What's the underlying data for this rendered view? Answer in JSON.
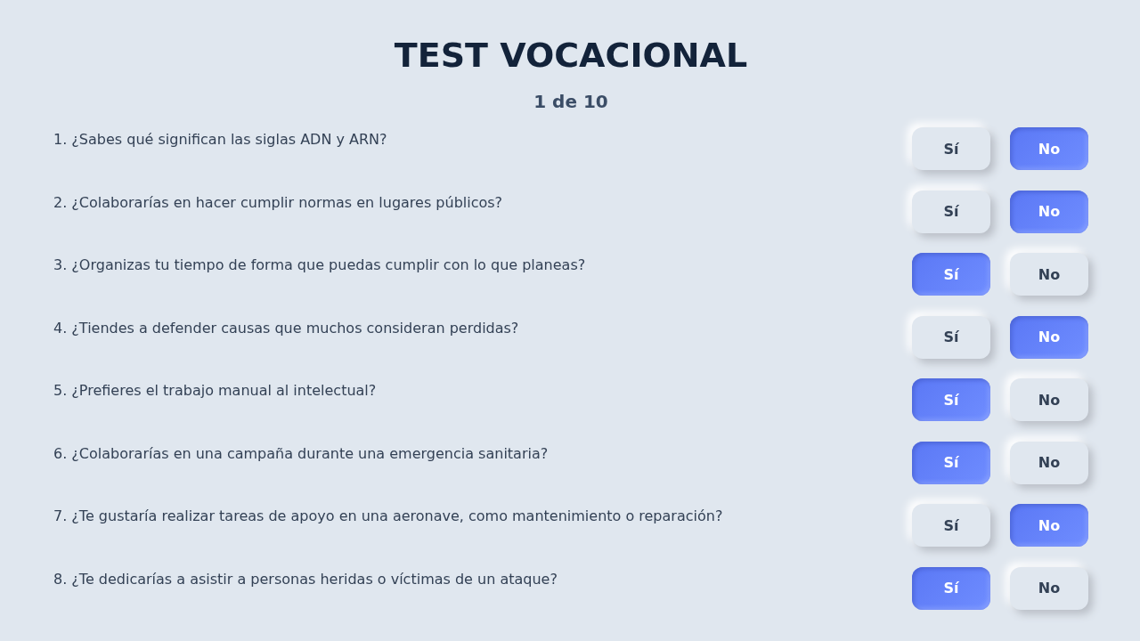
{
  "title": "TEST VOCACIONAL",
  "progress": "1 de 10",
  "questions": [
    {
      "text": "1. ¿Sabes qué significan las siglas ADN y ARN?",
      "options": [
        {
          "label": "Sí",
          "selected": false
        },
        {
          "label": "No",
          "selected": true
        }
      ]
    },
    {
      "text": "2. ¿Colaborarías en hacer cumplir normas en lugares públicos?",
      "options": [
        {
          "label": "Sí",
          "selected": false
        },
        {
          "label": "No",
          "selected": true
        }
      ]
    },
    {
      "text": "3. ¿Organizas tu tiempo de forma que puedas cumplir con lo que planeas?",
      "options": [
        {
          "label": "Sí",
          "selected": true
        },
        {
          "label": "No",
          "selected": false
        }
      ]
    },
    {
      "text": "4. ¿Tiendes a defender causas que muchos consideran perdidas?",
      "options": [
        {
          "label": "Sí",
          "selected": false
        },
        {
          "label": "No",
          "selected": true
        }
      ]
    },
    {
      "text": "5. ¿Prefieres el trabajo manual al intelectual?",
      "options": [
        {
          "label": "Sí",
          "selected": true
        },
        {
          "label": "No",
          "selected": false
        }
      ]
    },
    {
      "text": "6. ¿Colaborarías en una campaña durante una emergencia sanitaria?",
      "options": [
        {
          "label": "Sí",
          "selected": true
        },
        {
          "label": "No",
          "selected": false
        }
      ]
    },
    {
      "text": "7. ¿Te gustaría realizar tareas de apoyo en una aeronave, como mantenimiento o reparación?",
      "options": [
        {
          "label": "Sí",
          "selected": false
        },
        {
          "label": "No",
          "selected": true
        }
      ]
    },
    {
      "text": "8. ¿Te dedicarías a asistir a personas heridas o víctimas de un ataque?",
      "options": [
        {
          "label": "Sí",
          "selected": true
        },
        {
          "label": "No",
          "selected": false
        }
      ]
    }
  ]
}
